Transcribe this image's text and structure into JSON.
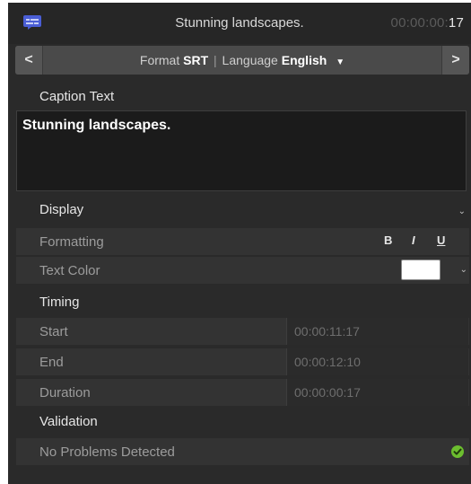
{
  "header": {
    "title": "Stunning landscapes.",
    "timecode_dim": "00:00:00:",
    "timecode_frames": "17",
    "icon": "captions-icon"
  },
  "format_bar": {
    "prev_label": "<",
    "next_label": ">",
    "format_prefix": "Format",
    "format_value": "SRT",
    "separator": "|",
    "language_prefix": "Language",
    "language_value": "English"
  },
  "caption": {
    "section_label": "Caption Text",
    "text": "Stunning landscapes."
  },
  "display": {
    "section_label": "Display",
    "formatting_label": "Formatting",
    "bold_label": "B",
    "italic_label": "I",
    "underline_label": "U",
    "text_color_label": "Text Color",
    "text_color_value": "#ffffff"
  },
  "timing": {
    "section_label": "Timing",
    "start_label": "Start",
    "start_value": "00:00:11:17",
    "end_label": "End",
    "end_value": "00:00:12:10",
    "duration_label": "Duration",
    "duration_value": "00:00:00:17"
  },
  "validation": {
    "section_label": "Validation",
    "status_text": "No Problems Detected",
    "status_color": "#6cbe2f"
  }
}
